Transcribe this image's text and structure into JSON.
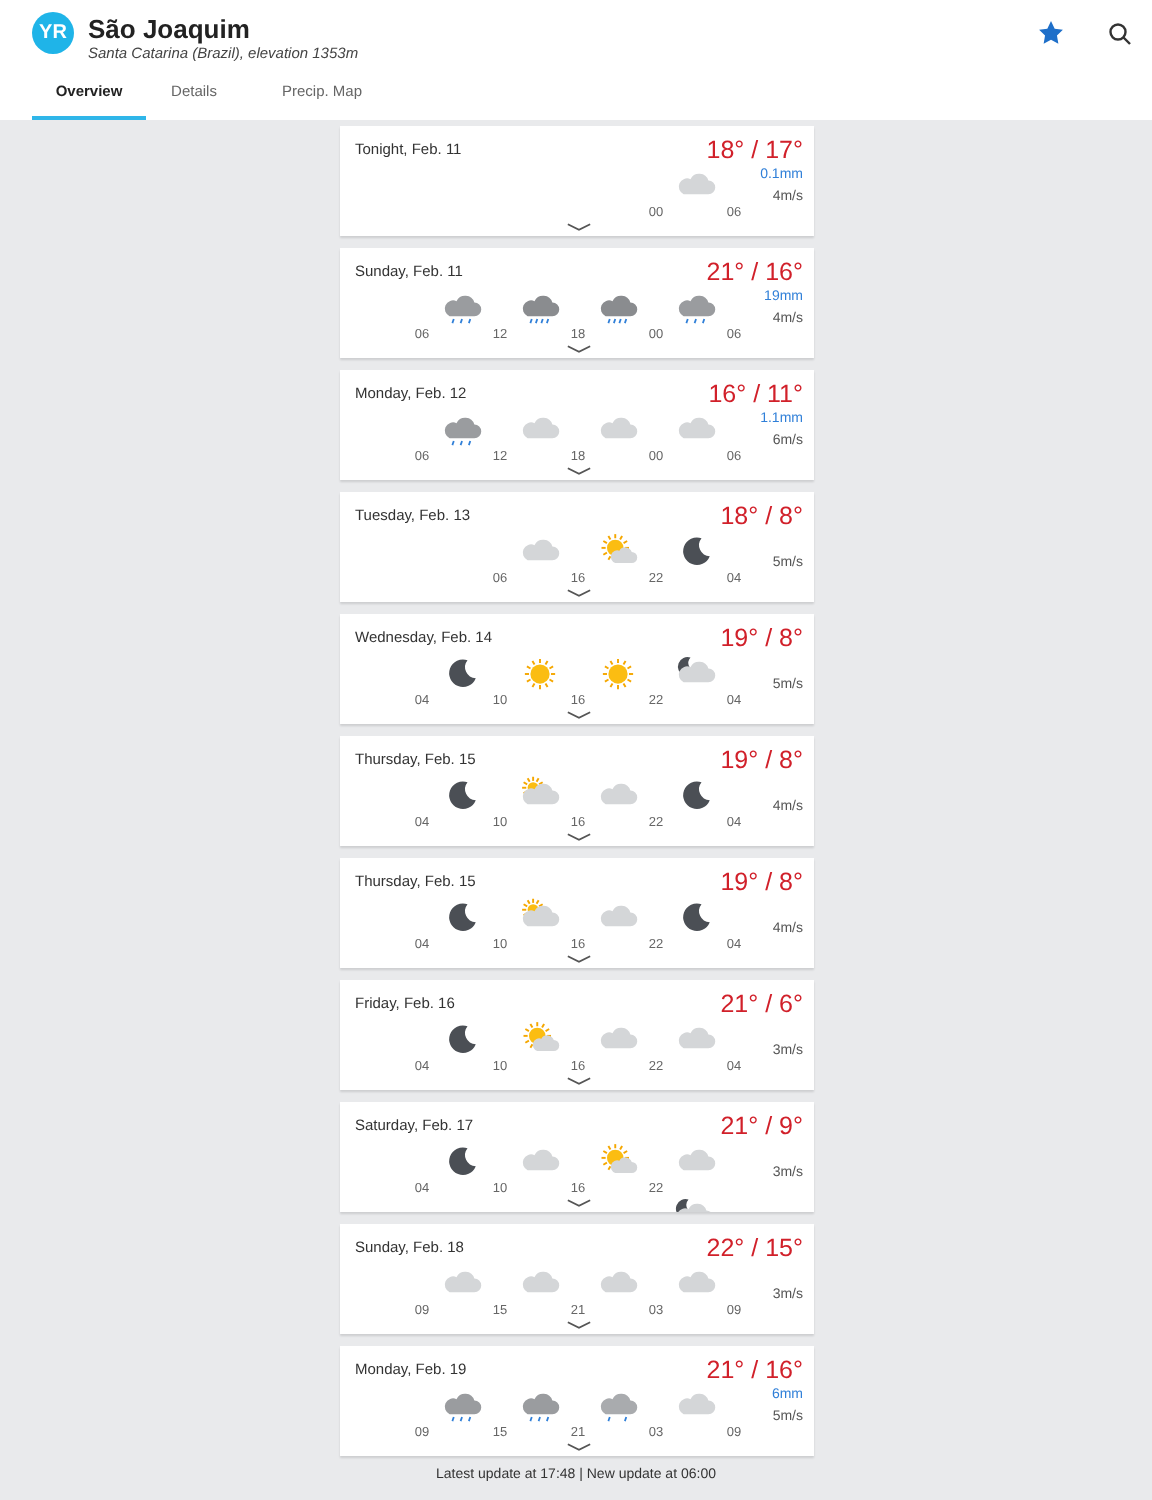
{
  "header": {
    "logo": "YR",
    "title": "São Joaquim",
    "subtitle": "Santa Catarina (Brazil), elevation 1353m"
  },
  "tabs": [
    {
      "label": "Overview",
      "selected": true
    },
    {
      "label": "Details",
      "selected": false
    },
    {
      "label": "Precip. Map",
      "selected": false
    }
  ],
  "days": [
    {
      "date": "Tonight, Feb. 11",
      "temps": "18° / 17°",
      "precip": "0.1mm",
      "wind": "4m/s",
      "align_end": true,
      "icons": [
        {
          "kind": "cloud"
        }
      ],
      "times": [
        "00",
        "06"
      ]
    },
    {
      "date": "Sunday, Feb. 11",
      "temps": "21° / 16°",
      "precip": "19mm",
      "wind": "4m/s",
      "icons": [
        {
          "kind": "rain"
        },
        {
          "kind": "heavy-rain"
        },
        {
          "kind": "heavy-rain"
        },
        {
          "kind": "rain"
        }
      ],
      "times": [
        "06",
        "12",
        "18",
        "00",
        "06"
      ]
    },
    {
      "date": "Monday, Feb. 12",
      "temps": "16° / 11°",
      "precip": "1.1mm",
      "wind": "6m/s",
      "icons": [
        {
          "kind": "rain"
        },
        {
          "kind": "cloud"
        },
        {
          "kind": "cloud"
        },
        {
          "kind": "cloud"
        }
      ],
      "times": [
        "06",
        "12",
        "18",
        "00",
        "06"
      ]
    },
    {
      "date": "Tuesday, Feb. 13",
      "temps": "18° / 8°",
      "wind": "5m/s",
      "align_end": true,
      "icons": [
        {
          "kind": "cloud"
        },
        {
          "kind": "sun-cloud"
        },
        {
          "kind": "moon"
        }
      ],
      "times": [
        "06",
        "16",
        "22",
        "04"
      ]
    },
    {
      "date": "Wednesday, Feb. 14",
      "temps": "19° / 8°",
      "wind": "5m/s",
      "icons": [
        {
          "kind": "moon"
        },
        {
          "kind": "sun"
        },
        {
          "kind": "sun"
        },
        {
          "kind": "moon-cloud"
        }
      ],
      "times": [
        "04",
        "10",
        "16",
        "22",
        "04"
      ]
    },
    {
      "date": "Thursday, Feb. 15",
      "temps": "19° / 8°",
      "wind": "4m/s",
      "icons": [
        {
          "kind": "moon"
        },
        {
          "kind": "partly-cloudy"
        },
        {
          "kind": "cloud"
        },
        {
          "kind": "moon"
        }
      ],
      "times": [
        "04",
        "10",
        "16",
        "22",
        "04"
      ]
    },
    {
      "date": "Thursday, Feb. 15",
      "temps": "19° / 8°",
      "wind": "4m/s",
      "icons": [
        {
          "kind": "moon"
        },
        {
          "kind": "partly-cloudy"
        },
        {
          "kind": "cloud"
        },
        {
          "kind": "moon"
        }
      ],
      "times": [
        "04",
        "10",
        "16",
        "22",
        "04"
      ]
    },
    {
      "date": "Friday, Feb. 16",
      "temps": "21° / 6°",
      "wind": "3m/s",
      "icons": [
        {
          "kind": "moon"
        },
        {
          "kind": "sun-cloud"
        },
        {
          "kind": "cloud"
        },
        {
          "kind": "cloud"
        }
      ],
      "times": [
        "04",
        "10",
        "16",
        "22",
        "04"
      ]
    },
    {
      "date": "Saturday, Feb. 17",
      "temps": "21° / 9°",
      "wind": "3m/s",
      "align_end": false,
      "icons": [
        {
          "kind": "moon"
        },
        {
          "kind": "cloud"
        },
        {
          "kind": "sun-cloud"
        },
        {
          "kind": "cloud"
        }
      ],
      "times": [
        "04",
        "10",
        "16",
        "22"
      ],
      "extra_icon": {
        "kind": "moon-cloud"
      }
    },
    {
      "date": "Sunday, Feb. 18",
      "temps": "22° / 15°",
      "wind": "3m/s",
      "icons": [
        {
          "kind": "cloud"
        },
        {
          "kind": "cloud"
        },
        {
          "kind": "cloud"
        },
        {
          "kind": "cloud"
        }
      ],
      "times": [
        "09",
        "15",
        "21",
        "03",
        "09"
      ]
    },
    {
      "date": "Monday, Feb. 19",
      "temps": "21° / 16°",
      "precip": "6mm",
      "wind": "5m/s",
      "icons": [
        {
          "kind": "rain"
        },
        {
          "kind": "rain"
        },
        {
          "kind": "light-rain"
        },
        {
          "kind": "cloud"
        }
      ],
      "times": [
        "09",
        "15",
        "21",
        "03",
        "09"
      ]
    }
  ],
  "footer": "Latest update at 17:48 | New update at 06:00"
}
